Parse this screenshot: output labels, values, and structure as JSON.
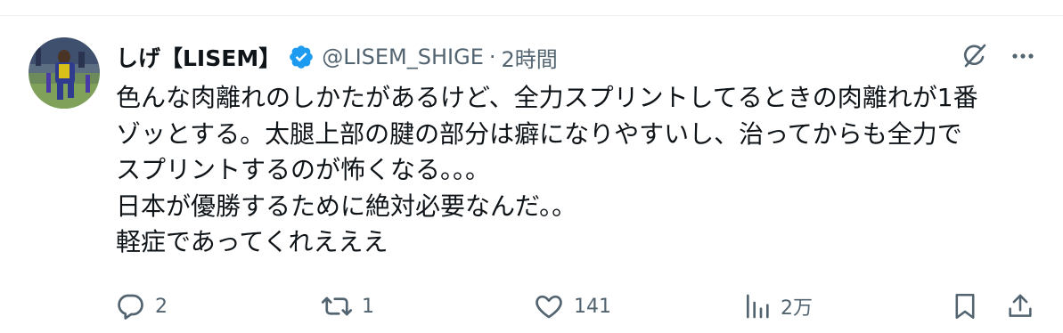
{
  "tweet": {
    "author": {
      "display_name": "しげ【LISEM】",
      "handle": "@LISEM_SHIGE",
      "separator": "·",
      "time": "2時間",
      "verified": true
    },
    "text_lines": [
      "色んな肉離れのしかたがあるけど、全力スプリントしてるときの肉離れが1番",
      "ゾッとする。太腿上部の腱の部分は癖になりやすいし、治ってからも全力で",
      "スプリントするのが怖くなる。。。",
      "日本が優勝するために絶対必要なんだ。。",
      "軽症であってくれえええ"
    ],
    "stats": {
      "replies": "2",
      "reposts": "1",
      "likes": "141",
      "views": "2万"
    }
  },
  "icons": {
    "verified": "verified-badge-icon",
    "grok": "grok-icon",
    "more": "more-icon",
    "reply": "reply-icon",
    "repost": "repost-icon",
    "like": "like-icon",
    "views": "views-icon",
    "bookmark": "bookmark-icon",
    "share": "share-icon"
  },
  "colors": {
    "text": "#0f1419",
    "secondary": "#536471",
    "verified": "#1d9bf0"
  }
}
